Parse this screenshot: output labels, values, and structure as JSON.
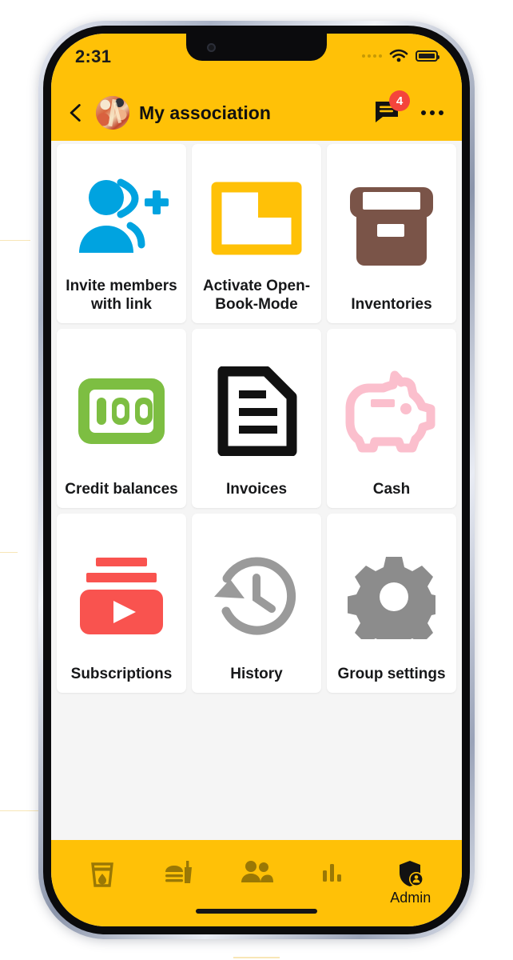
{
  "theme": {
    "brand_yellow": "#FFC107",
    "badge_red": "#F4453C",
    "screen_bg": "#F5F5F5",
    "card_bg": "#FFFFFF",
    "text_dark": "#17181A",
    "nav_inactive": "#9A7805",
    "nav_active": "#111111"
  },
  "status_bar": {
    "time": "2:31",
    "signal_icon": "signal-dots-icon",
    "wifi_icon": "wifi-icon",
    "battery_icon": "battery-full-icon"
  },
  "app_bar": {
    "back_icon": "chevron-left-icon",
    "avatar_icon": "group-avatar-photo",
    "title": "My association",
    "chat_icon": "chat-bubble-icon",
    "chat_badge": "4",
    "menu_icon": "more-options-icon"
  },
  "grid": {
    "items": [
      {
        "label": "Invite members with link",
        "icon": "person-add-icon",
        "color": "#00A3E0"
      },
      {
        "label": "Activate Open-Book-Mode",
        "icon": "folder-open-icon",
        "color": "#FFC107"
      },
      {
        "label": "Inventories",
        "icon": "archive-box-icon",
        "color": "#7A5448"
      },
      {
        "label": "Credit balances",
        "icon": "banknote-100-icon",
        "color": "#7DBE42"
      },
      {
        "label": "Invoices",
        "icon": "document-lines-icon",
        "color": "#111111"
      },
      {
        "label": "Cash",
        "icon": "piggy-bank-icon",
        "color": "#FBBFCD"
      },
      {
        "label": "Subscriptions",
        "icon": "subscriptions-play-icon",
        "color": "#F9534F"
      },
      {
        "label": "History",
        "icon": "history-clock-icon",
        "color": "#9A9A9A"
      },
      {
        "label": "Group settings",
        "icon": "gear-icon",
        "color": "#8C8C8C"
      }
    ]
  },
  "bottom_nav": {
    "items": [
      {
        "label": "",
        "icon": "drink-cup-icon",
        "active": false
      },
      {
        "label": "",
        "icon": "food-burger-icon",
        "active": false
      },
      {
        "label": "",
        "icon": "people-icon",
        "active": false
      },
      {
        "label": "",
        "icon": "bar-chart-icon",
        "active": false
      },
      {
        "label": "Admin",
        "icon": "admin-shield-icon",
        "active": true
      }
    ]
  }
}
